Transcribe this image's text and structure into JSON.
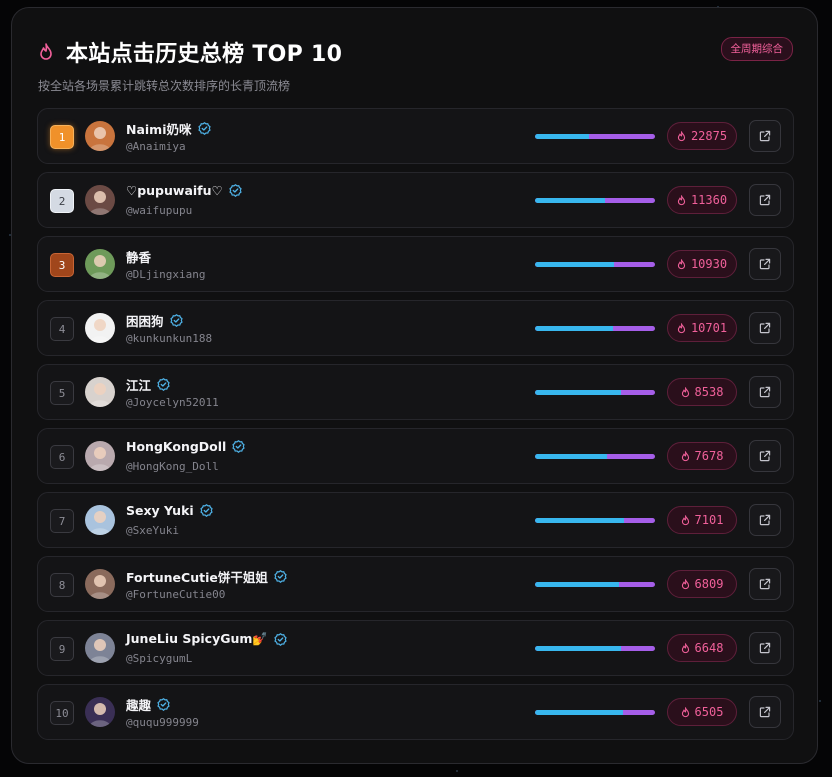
{
  "header": {
    "title": "本站点击历史总榜 TOP 10",
    "subtitle": "按全站各场景累计跳转总次数排序的长青顶流榜",
    "badge": "全周期综合"
  },
  "colors": {
    "accent_pink": "#f0609a",
    "bar_blue": "#38b7ee",
    "bar_purple": "#a55ee8",
    "gold": "#f0912a",
    "silver": "#d4dae3",
    "bronze": "#a0461b",
    "verified_blue": "#4fb3e8"
  },
  "icons": {
    "title": "flame-icon",
    "score": "flame-icon",
    "verified": "verified-badge-icon",
    "open": "external-link-icon"
  },
  "entries": [
    {
      "rank": "1",
      "name": "Naimi奶咪",
      "handle": "@Anaimiya",
      "verified": true,
      "score": "22875",
      "share": 0.45,
      "avatar_bg": "#c9743d"
    },
    {
      "rank": "2",
      "name": "♡pupuwaifu♡",
      "handle": "@waifupupu",
      "verified": true,
      "score": "11360",
      "share": 0.58,
      "avatar_bg": "#6b4a44"
    },
    {
      "rank": "3",
      "name": "静香",
      "handle": "@DLjingxiang",
      "verified": false,
      "score": "10930",
      "share": 0.66,
      "avatar_bg": "#6e9a5a"
    },
    {
      "rank": "4",
      "name": "困困狗",
      "handle": "@kunkunkun188",
      "verified": true,
      "score": "10701",
      "share": 0.65,
      "avatar_bg": "#f2f2f2"
    },
    {
      "rank": "5",
      "name": "江江",
      "handle": "@Joycelyn52011",
      "verified": true,
      "score": "8538",
      "share": 0.72,
      "avatar_bg": "#d8d2ce"
    },
    {
      "rank": "6",
      "name": "HongKongDoll",
      "handle": "@HongKong_Doll",
      "verified": true,
      "score": "7678",
      "share": 0.6,
      "avatar_bg": "#b9a9ae"
    },
    {
      "rank": "7",
      "name": "Sexy Yuki",
      "handle": "@SxeYuki",
      "verified": true,
      "score": "7101",
      "share": 0.74,
      "avatar_bg": "#a9c3de"
    },
    {
      "rank": "8",
      "name": "FortuneCutie饼干姐姐",
      "handle": "@FortuneCutie00",
      "verified": true,
      "score": "6809",
      "share": 0.7,
      "avatar_bg": "#8a6a5c"
    },
    {
      "rank": "9",
      "name": "JuneLiu SpicyGum💅",
      "handle": "@SpicygumL",
      "verified": true,
      "score": "6648",
      "share": 0.72,
      "avatar_bg": "#7d8396"
    },
    {
      "rank": "10",
      "name": "趣趣",
      "handle": "@ququ999999",
      "verified": true,
      "score": "6505",
      "share": 0.73,
      "avatar_bg": "#3a2f55"
    }
  ]
}
